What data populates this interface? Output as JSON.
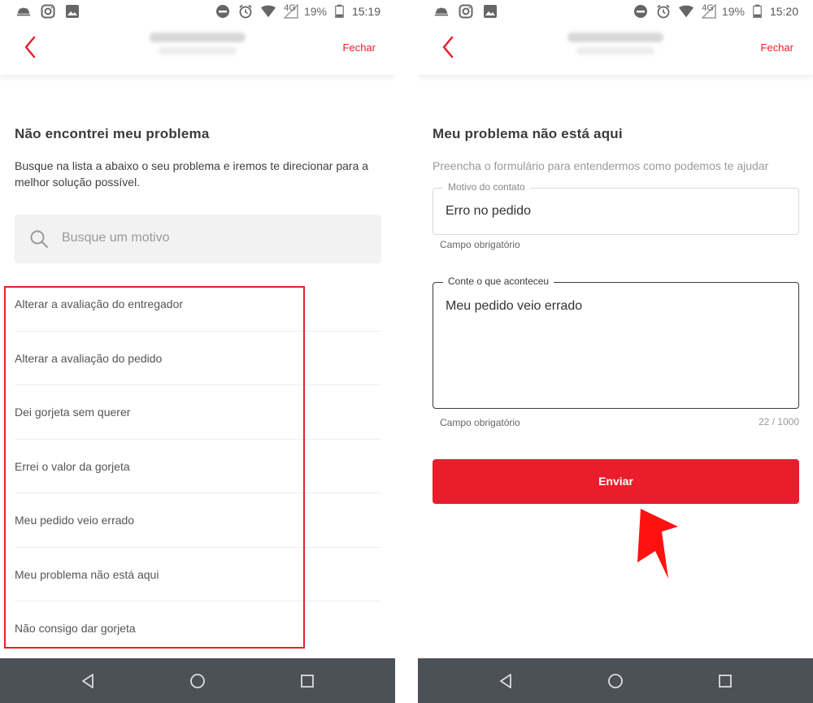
{
  "left": {
    "status": {
      "signal": "4G",
      "battery": "19%",
      "time": "15:19"
    },
    "header": {
      "close_label": "Fechar"
    },
    "title": "Não encontrei meu problema",
    "description": "Busque na lista a abaixo o seu problema e iremos te direcionar para a melhor solução possível.",
    "search": {
      "placeholder": "Busque um motivo"
    },
    "reasons": [
      "Alterar a avaliação do entregador",
      "Alterar a avaliação do pedido",
      "Dei gorjeta sem querer",
      "Errei o valor da gorjeta",
      "Meu pedido veio errado",
      "Meu problema não está aqui",
      "Não consigo dar gorjeta"
    ]
  },
  "right": {
    "status": {
      "signal": "4G",
      "battery": "19%",
      "time": "15:20"
    },
    "header": {
      "close_label": "Fechar"
    },
    "title": "Meu problema não está aqui",
    "subtitle": "Preencha o formulário para entendermos como podemos te ajudar",
    "contact_reason": {
      "label": "Motivo do contato",
      "value": "Erro no pedido",
      "helper": "Campo obrigatório"
    },
    "what_happened": {
      "label": "Conte o que aconteceu",
      "value": "Meu pedido veio errado",
      "helper": "Campo obrigatório",
      "counter": "22 / 1000"
    },
    "submit_label": "Enviar"
  },
  "colors": {
    "accent": "#ea1d2c",
    "navbar": "#4b5157",
    "annotation": "#e52229"
  }
}
